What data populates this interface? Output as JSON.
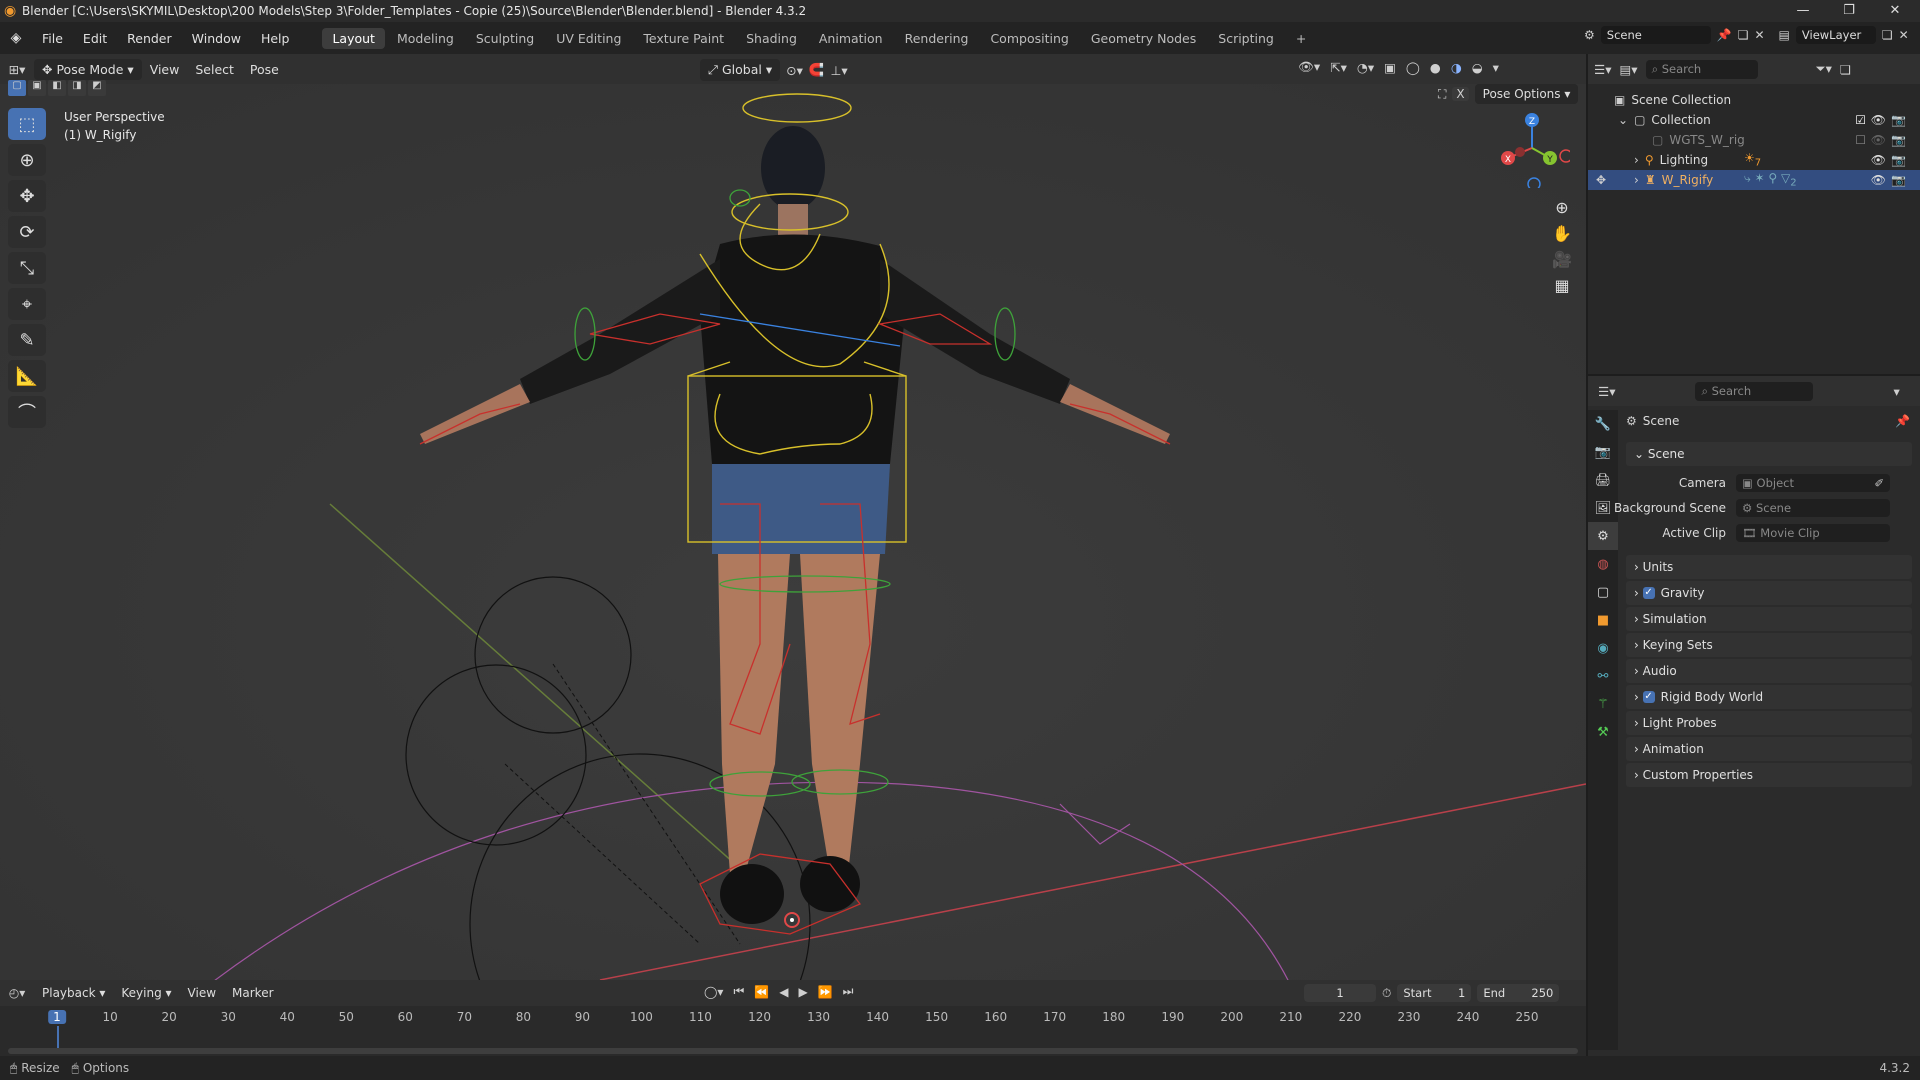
{
  "title": "Blender [C:\\Users\\SKYMIL\\Desktop\\200 Models\\Step 3\\Folder_Templates - Copie (25)\\Source\\Blender\\Blender.blend] - Blender 4.3.2",
  "menus": [
    "File",
    "Edit",
    "Render",
    "Window",
    "Help"
  ],
  "workspaces": [
    {
      "label": "Layout",
      "active": true
    },
    {
      "label": "Modeling"
    },
    {
      "label": "Sculpting"
    },
    {
      "label": "UV Editing"
    },
    {
      "label": "Texture Paint"
    },
    {
      "label": "Shading"
    },
    {
      "label": "Animation"
    },
    {
      "label": "Rendering"
    },
    {
      "label": "Compositing"
    },
    {
      "label": "Geometry Nodes"
    },
    {
      "label": "Scripting"
    }
  ],
  "add_workspace": "+",
  "scene_field": "Scene",
  "viewlayer_field": "ViewLayer",
  "viewport_header": {
    "mode": "Pose Mode",
    "menus": [
      "View",
      "Select",
      "Pose"
    ],
    "orientation": "Global",
    "pose_options": "Pose Options",
    "close": "X"
  },
  "viewport": {
    "perspective": "User Perspective",
    "object": "(1) W_Rigify",
    "gizmo": {
      "x": "X",
      "y": "Y",
      "z": "Z"
    }
  },
  "outliner": {
    "search_placeholder": "Search",
    "root": "Scene Collection",
    "collection": "Collection",
    "items": [
      "WGTS_W_rig",
      "Lighting",
      "W_Rigify"
    ],
    "lighting_count": "7",
    "rigify_count": "2"
  },
  "properties": {
    "search_placeholder": "Search",
    "breadcrumb": "Scene",
    "section": "Scene",
    "camera_label": "Camera",
    "camera_value": "Object",
    "bg_label": "Background Scene",
    "bg_value": "Scene",
    "clip_label": "Active Clip",
    "clip_value": "Movie Clip",
    "panels": [
      {
        "label": "Units",
        "check": false
      },
      {
        "label": "Gravity",
        "check": true
      },
      {
        "label": "Simulation",
        "check": false
      },
      {
        "label": "Keying Sets",
        "check": false
      },
      {
        "label": "Audio",
        "check": false
      },
      {
        "label": "Rigid Body World",
        "check": true
      },
      {
        "label": "Light Probes",
        "check": false
      },
      {
        "label": "Animation",
        "check": false
      },
      {
        "label": "Custom Properties",
        "check": false
      }
    ],
    "check_mark": "✓"
  },
  "timeline": {
    "menus": [
      "Playback",
      "Keying",
      "View",
      "Marker"
    ],
    "current_frame": "1",
    "start_label": "Start",
    "start": "1",
    "end_label": "End",
    "end": "250",
    "ruler": [
      "1",
      "10",
      "20",
      "30",
      "40",
      "50",
      "60",
      "70",
      "80",
      "90",
      "100",
      "110",
      "120",
      "130",
      "140",
      "150",
      "160",
      "170",
      "180",
      "190",
      "200",
      "210",
      "220",
      "230",
      "240",
      "250"
    ]
  },
  "status": {
    "resize": "Resize",
    "options": "Options",
    "version": "4.3.2"
  },
  "colors": {
    "accent": "#4772b3",
    "bone_yellow": "#d8c02a",
    "bone_red": "#c8302c",
    "bone_green": "#3ea23a",
    "axis_x": "#e04848",
    "axis_y": "#86c430",
    "axis_z": "#3a82e0"
  }
}
